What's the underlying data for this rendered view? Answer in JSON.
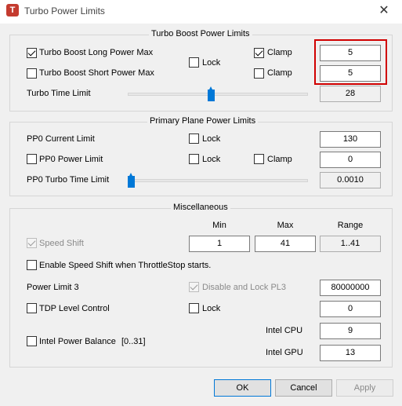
{
  "window": {
    "title": "Turbo Power Limits",
    "icon_letter": "T",
    "close_glyph": "✕"
  },
  "turbo_boost": {
    "title": "Turbo Boost Power Limits",
    "long_label": "Turbo Boost Long Power Max",
    "long_checked": true,
    "short_label": "Turbo Boost Short Power Max",
    "short_checked": false,
    "lock_label": "Lock",
    "lock_checked": false,
    "clamp_long_label": "Clamp",
    "clamp_long_checked": true,
    "clamp_short_label": "Clamp",
    "clamp_short_checked": false,
    "long_value": "5",
    "short_value": "5",
    "time_limit_label": "Turbo Time Limit",
    "time_limit_value": "28",
    "time_limit_slider_fraction": 0.46
  },
  "primary_plane": {
    "title": "Primary Plane Power Limits",
    "current_limit_label": "PP0 Current Limit",
    "current_lock_label": "Lock",
    "current_value": "130",
    "power_limit_label": "PP0 Power Limit",
    "power_lock_label": "Lock",
    "clamp_label": "Clamp",
    "power_value": "0",
    "turbo_time_label": "PP0 Turbo Time Limit",
    "turbo_time_value": "0.0010",
    "turbo_time_slider_fraction": 0.0
  },
  "misc": {
    "title": "Miscellaneous",
    "col_min": "Min",
    "col_max": "Max",
    "col_range": "Range",
    "speed_shift_label": "Speed Shift",
    "speed_shift_min": "1",
    "speed_shift_max": "41",
    "speed_shift_range": "1..41",
    "enable_speed_shift_label": "Enable Speed Shift when ThrottleStop starts.",
    "power_limit3_label": "Power Limit 3",
    "disable_lock_pl3_label": "Disable and Lock PL3",
    "pl3_value": "80000000",
    "tdp_label": "TDP Level Control",
    "tdp_lock_label": "Lock",
    "tdp_value": "0",
    "intel_cpu_label": "Intel CPU",
    "intel_cpu_value": "9",
    "intel_power_balance_label": "Intel Power Balance",
    "intel_power_balance_range": "[0..31]",
    "intel_gpu_label": "Intel GPU",
    "intel_gpu_value": "13"
  },
  "buttons": {
    "ok": "OK",
    "cancel": "Cancel",
    "apply": "Apply"
  }
}
